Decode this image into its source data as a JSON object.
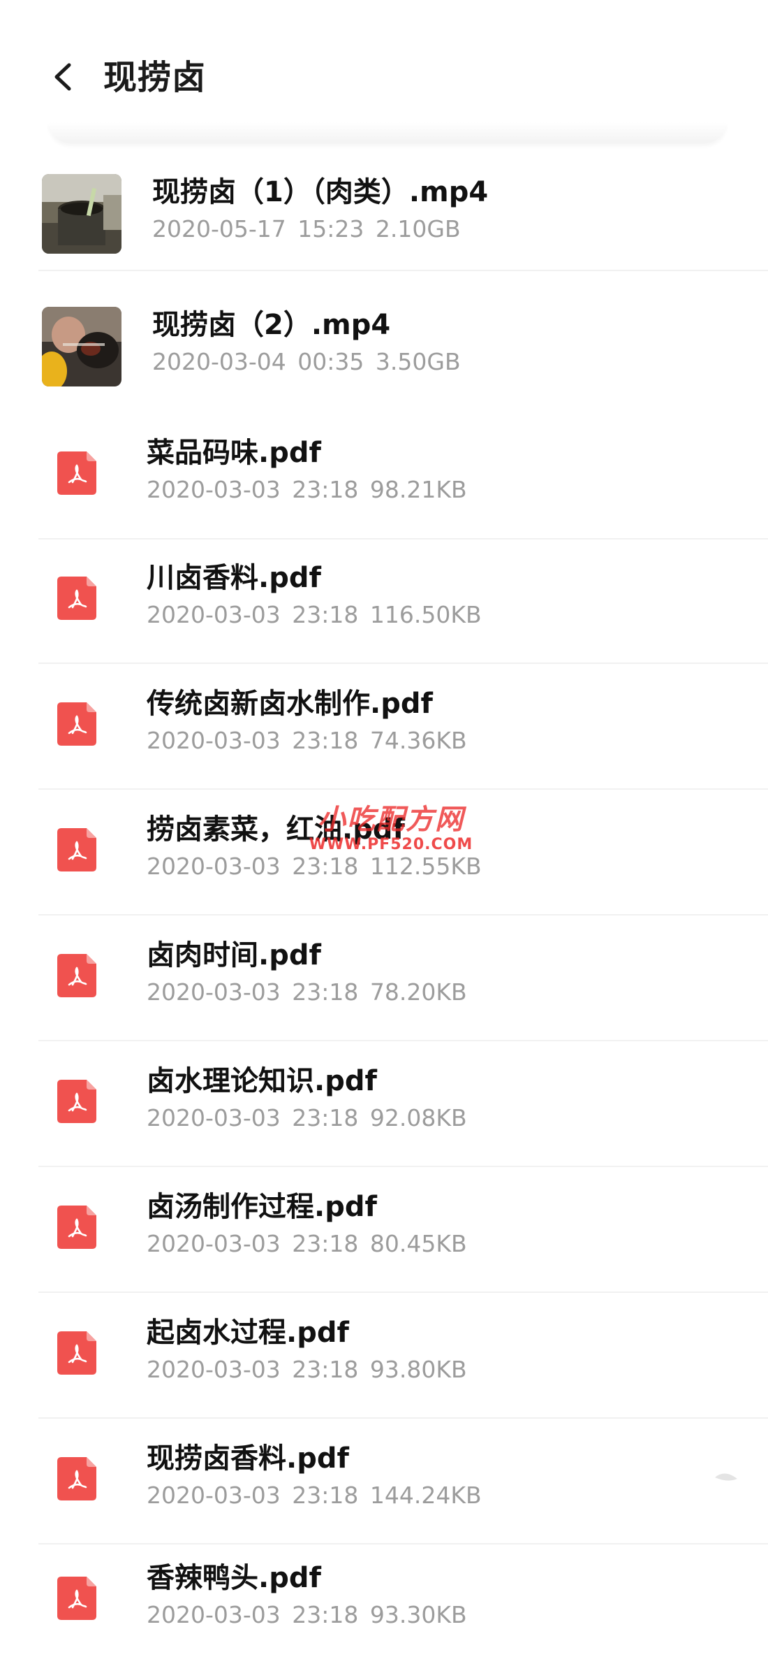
{
  "header": {
    "title": "现捞卤"
  },
  "files": [
    {
      "name": "现捞卤（1）（肉类）.mp4",
      "date": "2020-05-17",
      "time": "15:23",
      "size": "2.10GB",
      "kind": "video",
      "icon": "video-thumbnail"
    },
    {
      "name": "现捞卤（2）.mp4",
      "date": "2020-03-04",
      "time": "00:35",
      "size": "3.50GB",
      "kind": "video",
      "icon": "video-thumbnail"
    },
    {
      "name": "菜品码味.pdf",
      "date": "2020-03-03",
      "time": "23:18",
      "size": "98.21KB",
      "kind": "pdf",
      "icon": "pdf-icon"
    },
    {
      "name": "川卤香料.pdf",
      "date": "2020-03-03",
      "time": "23:18",
      "size": "116.50KB",
      "kind": "pdf",
      "icon": "pdf-icon"
    },
    {
      "name": "传统卤新卤水制作.pdf",
      "date": "2020-03-03",
      "time": "23:18",
      "size": "74.36KB",
      "kind": "pdf",
      "icon": "pdf-icon"
    },
    {
      "name": "捞卤素菜，红油.pdf",
      "date": "2020-03-03",
      "time": "23:18",
      "size": "112.55KB",
      "kind": "pdf",
      "icon": "pdf-icon"
    },
    {
      "name": "卤肉时间.pdf",
      "date": "2020-03-03",
      "time": "23:18",
      "size": "78.20KB",
      "kind": "pdf",
      "icon": "pdf-icon"
    },
    {
      "name": "卤水理论知识.pdf",
      "date": "2020-03-03",
      "time": "23:18",
      "size": "92.08KB",
      "kind": "pdf",
      "icon": "pdf-icon"
    },
    {
      "name": "卤汤制作过程.pdf",
      "date": "2020-03-03",
      "time": "23:18",
      "size": "80.45KB",
      "kind": "pdf",
      "icon": "pdf-icon"
    },
    {
      "name": "起卤水过程.pdf",
      "date": "2020-03-03",
      "time": "23:18",
      "size": "93.80KB",
      "kind": "pdf",
      "icon": "pdf-icon"
    },
    {
      "name": "现捞卤香料.pdf",
      "date": "2020-03-03",
      "time": "23:18",
      "size": "144.24KB",
      "kind": "pdf",
      "icon": "pdf-icon"
    },
    {
      "name": "香辣鸭头.pdf",
      "date": "2020-03-03",
      "time": "23:18",
      "size": "93.30KB",
      "kind": "pdf",
      "icon": "pdf-icon"
    }
  ],
  "watermark": {
    "main": "小吃配方网",
    "sub": "WWW.PF520.COM"
  },
  "colors": {
    "pdf_red": "#f0524f",
    "meta_gray": "#9c9c9c",
    "divider": "#f1f1f1",
    "watermark_red": "#ec2a2a"
  }
}
